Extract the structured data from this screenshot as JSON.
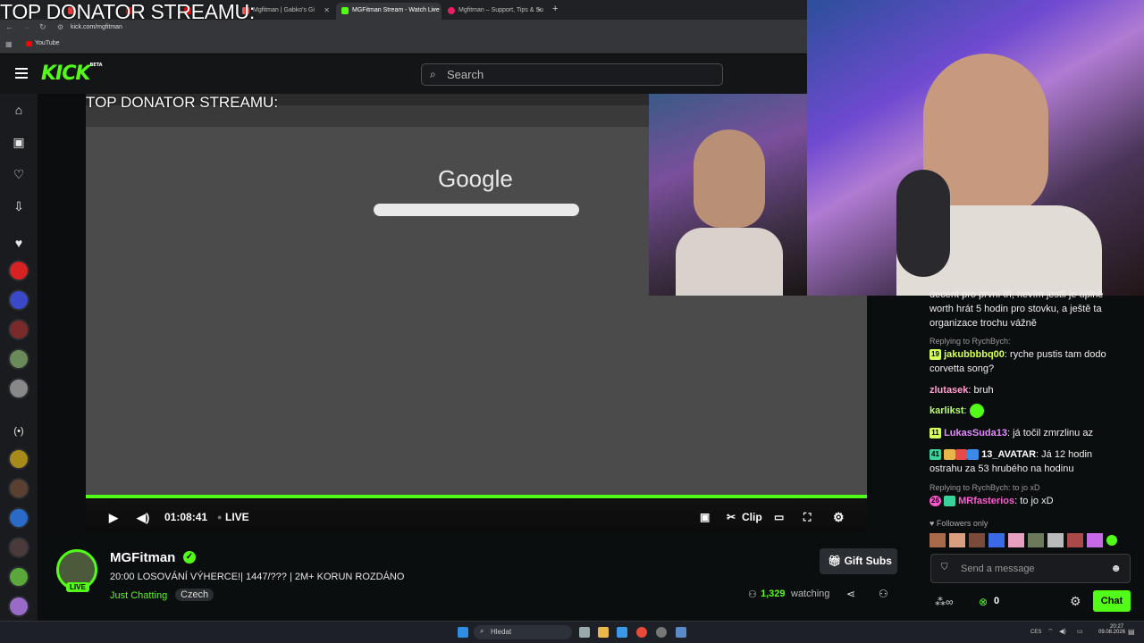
{
  "overlay_title": "TOP DONATOR STREAMU:",
  "browser": {
    "tabs": [
      {
        "label": "",
        "color": "#e53935"
      },
      {
        "label": "",
        "color": "#ff0000"
      },
      {
        "label": "",
        "color": "#ff0000"
      },
      {
        "label": "Mgfitman | Gabko's Gi",
        "color": "#ff5a5a"
      },
      {
        "label": "MGFitman Stream - Watch Live",
        "color": "#53fc18"
      },
      {
        "label": "Mgfitman – Support, Tips & Su",
        "color": "#e91e63"
      }
    ],
    "url": "kick.com/mgfitman",
    "bookmark": "YouTube"
  },
  "kick": {
    "logo": "KICK",
    "logo_badge": "BETA",
    "search_placeholder": "Search"
  },
  "inner_screen": {
    "title": "TOP DONATOR STREAMU:",
    "google": "Google"
  },
  "player": {
    "time": "01:08:41",
    "live": "LIVE",
    "clip": "Clip",
    "progress_pct": 100
  },
  "channel": {
    "name": "MGFitman",
    "live_badge": "LIVE",
    "title": "20:00 LOSOVÁNÍ VÝHERCE!| 1447/??? | 2M+ KORUN ROZDÁNO",
    "category": "Just Chatting",
    "tag": "Czech",
    "viewers": "1,329",
    "watching": "watching",
    "gift_subs": "Gift Subs",
    "accent": "#53fc18"
  },
  "chat": {
    "top_text": "decent pro první tři, nevím jestli je úplně worth hrát 5 hodin pro stovku, a ještě ta organizace trochu vážně",
    "messages": [
      {
        "reply": "Replying to RychBych:",
        "badge": "19",
        "user": "jakubbbbq00",
        "text": "ryche pustis tam dodo corvetta song?",
        "user_color": "#d6ff5a"
      },
      {
        "reply": "",
        "badge": "",
        "user": "zlutasek",
        "text": "bruh",
        "user_color": "#ff9ecf"
      },
      {
        "reply": "",
        "badge": "",
        "user": "karlikst",
        "text": "",
        "user_color": "#b6ff6e"
      },
      {
        "reply": "",
        "badge": "11",
        "user": "LukasSuda13",
        "text": "já točil zmrzlinu az",
        "user_color": "#e48cff"
      },
      {
        "reply": "",
        "badge": "41",
        "user": "13_AVATAR",
        "text": "Já 12 hodin ostrahu za 53 hrubého na hodinu",
        "user_color": "#ffffff"
      },
      {
        "reply": "Replying to RychBych: to jo xD",
        "badge": "26",
        "user": "MRfasterios",
        "text": "to jo xD",
        "user_color": "#ff5ad1"
      }
    ],
    "followers_only": "Followers only",
    "send_placeholder": "Send a message",
    "points": "0",
    "chat_button": "Chat"
  },
  "taskbar": {
    "search": "Hledat",
    "lang": "CES",
    "time": "20:27",
    "date": "09.08.2026"
  }
}
